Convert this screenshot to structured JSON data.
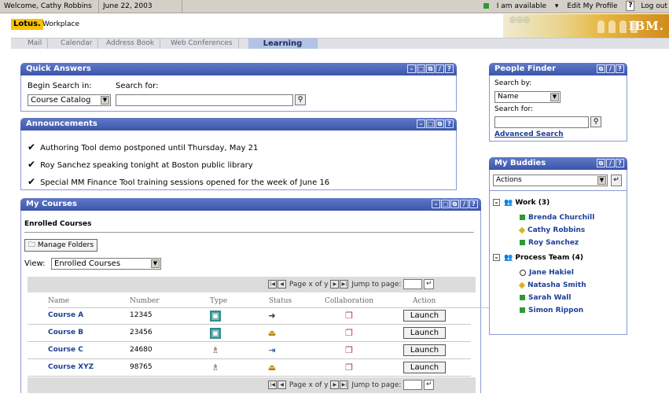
{
  "topbar": {
    "welcome": "Welcome, Cathy Robbins",
    "date": "June 22, 2003",
    "availability": "I am available",
    "edit_profile": "Edit My Profile",
    "help": "?",
    "logout": "Log out"
  },
  "header": {
    "brand": "Lotus.",
    "product": "Workplace",
    "company": "IBM."
  },
  "tabs": [
    {
      "label": "Mail"
    },
    {
      "label": "Calendar"
    },
    {
      "label": "Address Book"
    },
    {
      "label": "Web Conferences"
    },
    {
      "label": "Learning",
      "active": true
    }
  ],
  "quick_answers": {
    "title": "Quick Answers",
    "begin_label": "Begin Search in:",
    "search_label": "Search for:",
    "begin_value": "Course Catalog",
    "search_value": ""
  },
  "announcements": {
    "title": "Announcements",
    "items": [
      "Authoring Tool demo postponed until Thursday, May 21",
      "Roy Sanchez speaking tonight at Boston public library",
      "Special MM Finance Tool training sessions opened for the week of June 16"
    ]
  },
  "my_courses": {
    "title": "My Courses",
    "section": "Enrolled Courses",
    "manage_folders": "Manage Folders",
    "view_label": "View:",
    "view_value": "Enrolled Courses",
    "pager_text": "Page x of y",
    "jump_label": "Jump to page:",
    "columns": [
      "Name",
      "Number",
      "Type",
      "Status",
      "Collaboration",
      "Action"
    ],
    "rows": [
      {
        "name": "Course A",
        "number": "12345",
        "action": "Launch"
      },
      {
        "name": "Course B",
        "number": "23456",
        "action": "Launch"
      },
      {
        "name": "Course C",
        "number": "24680",
        "action": "Launch"
      },
      {
        "name": "Course XYZ",
        "number": "98765",
        "action": "Launch"
      }
    ]
  },
  "people_finder": {
    "title": "People Finder",
    "search_by_label": "Search by:",
    "search_by_value": "Name",
    "search_for_label": "Search for:",
    "search_value": "",
    "advanced": "Advanced Search"
  },
  "my_buddies": {
    "title": "My Buddies",
    "actions_value": "Actions",
    "groups": [
      {
        "label": "Work (3)",
        "members": [
          {
            "name": "Brenda Churchill",
            "status": "available"
          },
          {
            "name": "Cathy Robbins",
            "status": "away"
          },
          {
            "name": "Roy Sanchez",
            "status": "available"
          }
        ]
      },
      {
        "label": "Process Team (4)",
        "members": [
          {
            "name": "Jane Hakiel",
            "status": "dnd"
          },
          {
            "name": "Natasha Smith",
            "status": "away"
          },
          {
            "name": "Sarah Wall",
            "status": "available"
          },
          {
            "name": "Simon Rippon",
            "status": "available"
          }
        ]
      }
    ]
  },
  "colors": {
    "panel_title": "#3b55aa",
    "link": "#1f3f92",
    "available": "#2d9a32",
    "away": "#d8b425"
  }
}
